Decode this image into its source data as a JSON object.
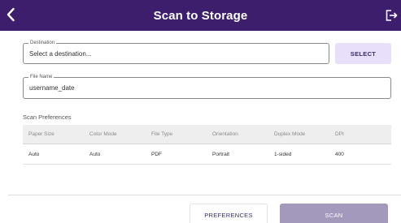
{
  "header": {
    "title": "Scan to Storage",
    "back_icon": "chevron-left-icon",
    "logout_icon": "logout-icon",
    "background_color": "#3d1e6d"
  },
  "destination": {
    "legend": "Destination",
    "placeholder": "Select a destination...",
    "select_label": "SELECT"
  },
  "file_name": {
    "legend": "File Name",
    "value": "username_date"
  },
  "preferences": {
    "section_label": "Scan Preferences",
    "columns": [
      "Paper Size",
      "Color Mode",
      "File Type",
      "Orientation",
      "Duplex Mode",
      "DPI"
    ],
    "row": [
      "Auto",
      "Auto",
      "PDF",
      "Portrait",
      "1-sided",
      "400"
    ]
  },
  "footer": {
    "preferences_label": "PREFERENCES",
    "scan_label": "SCAN",
    "scan_color": "#a399bd"
  }
}
